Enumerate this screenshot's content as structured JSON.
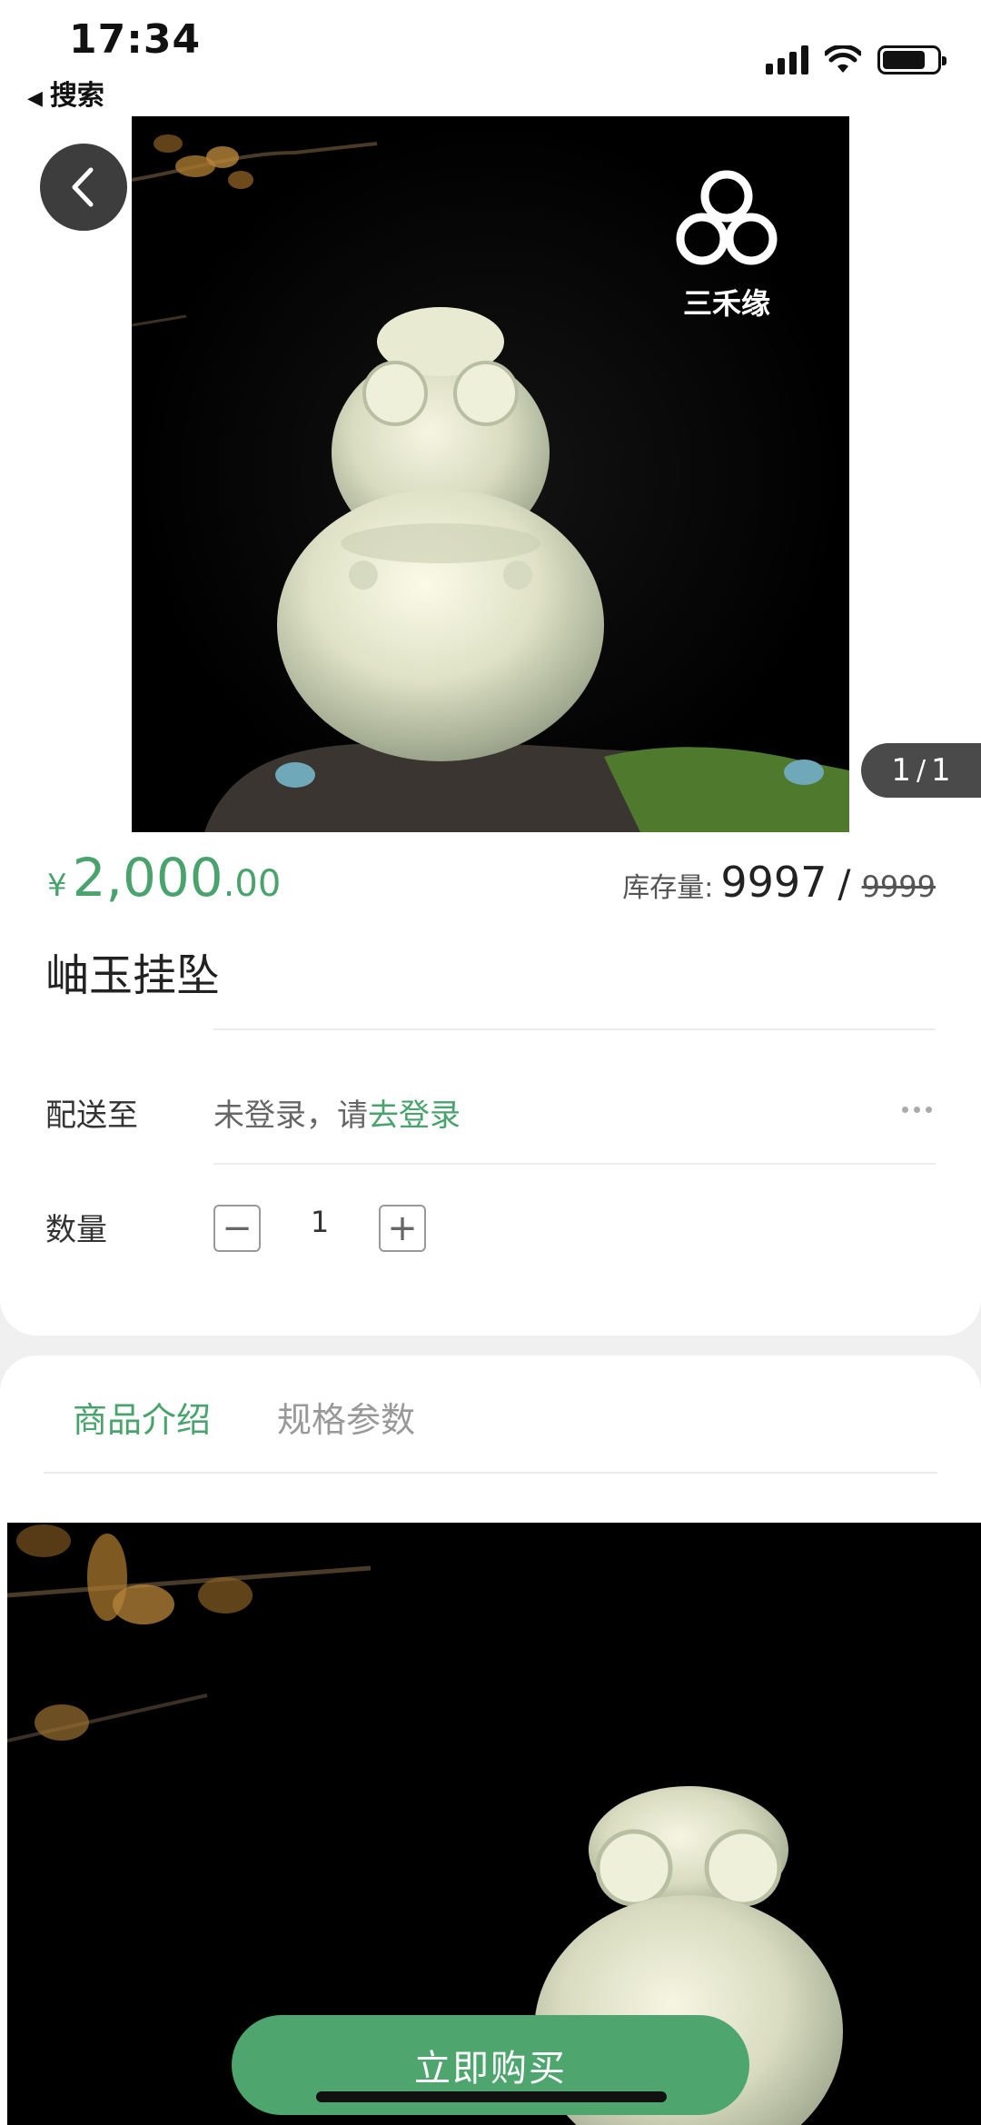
{
  "status_bar": {
    "time": "17:34",
    "back_app_label": "搜索"
  },
  "gallery": {
    "current_page": "1",
    "separator": "/",
    "total_pages": "1",
    "brand_logo_text": "三禾缘",
    "back_icon": "chevron-left-icon"
  },
  "product": {
    "currency": "¥",
    "price_integer": "2,000",
    "price_decimal": ".00",
    "stock_label": "库存量:",
    "stock_value": "9997",
    "stock_separator": "/",
    "stock_original": "9999",
    "title": "岫玉挂坠"
  },
  "delivery": {
    "label": "配送至",
    "status_text": "未登录，请",
    "login_link": "去登录"
  },
  "quantity": {
    "label": "数量",
    "minus": "−",
    "value": "1",
    "plus": "+"
  },
  "tabs": [
    {
      "label": "商品介绍",
      "active": true
    },
    {
      "label": "规格参数",
      "active": false
    }
  ],
  "actions": {
    "buy_now": "立即购买"
  },
  "colors": {
    "accent": "#4aa36d",
    "buy_button": "#4ea56e"
  }
}
